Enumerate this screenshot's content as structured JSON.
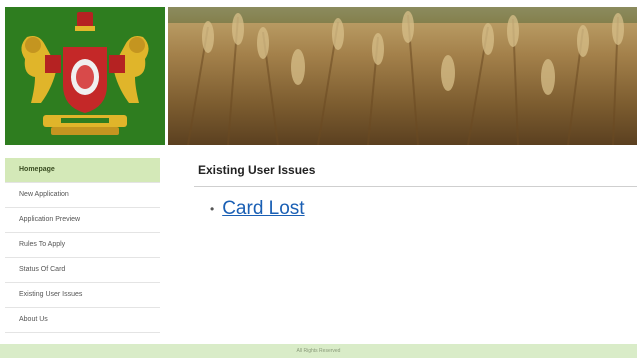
{
  "sidebar": {
    "items": [
      {
        "label": "Homepage",
        "active": true
      },
      {
        "label": "New Application",
        "active": false
      },
      {
        "label": "Application Preview",
        "active": false
      },
      {
        "label": "Rules To Apply",
        "active": false
      },
      {
        "label": "Status Of Card",
        "active": false
      },
      {
        "label": "Existing User Issues",
        "active": false
      },
      {
        "label": "About Us",
        "active": false
      }
    ]
  },
  "main": {
    "title": "Existing User Issues",
    "issues": [
      {
        "label": "Card Lost"
      }
    ]
  },
  "footer": {
    "text": "All Rights Reserved"
  },
  "colors": {
    "emblem_bg": "#2e7d1f",
    "active_nav_bg": "#d4e9b8",
    "link": "#1a5fb4",
    "footer_bg": "#d9ecc8"
  }
}
